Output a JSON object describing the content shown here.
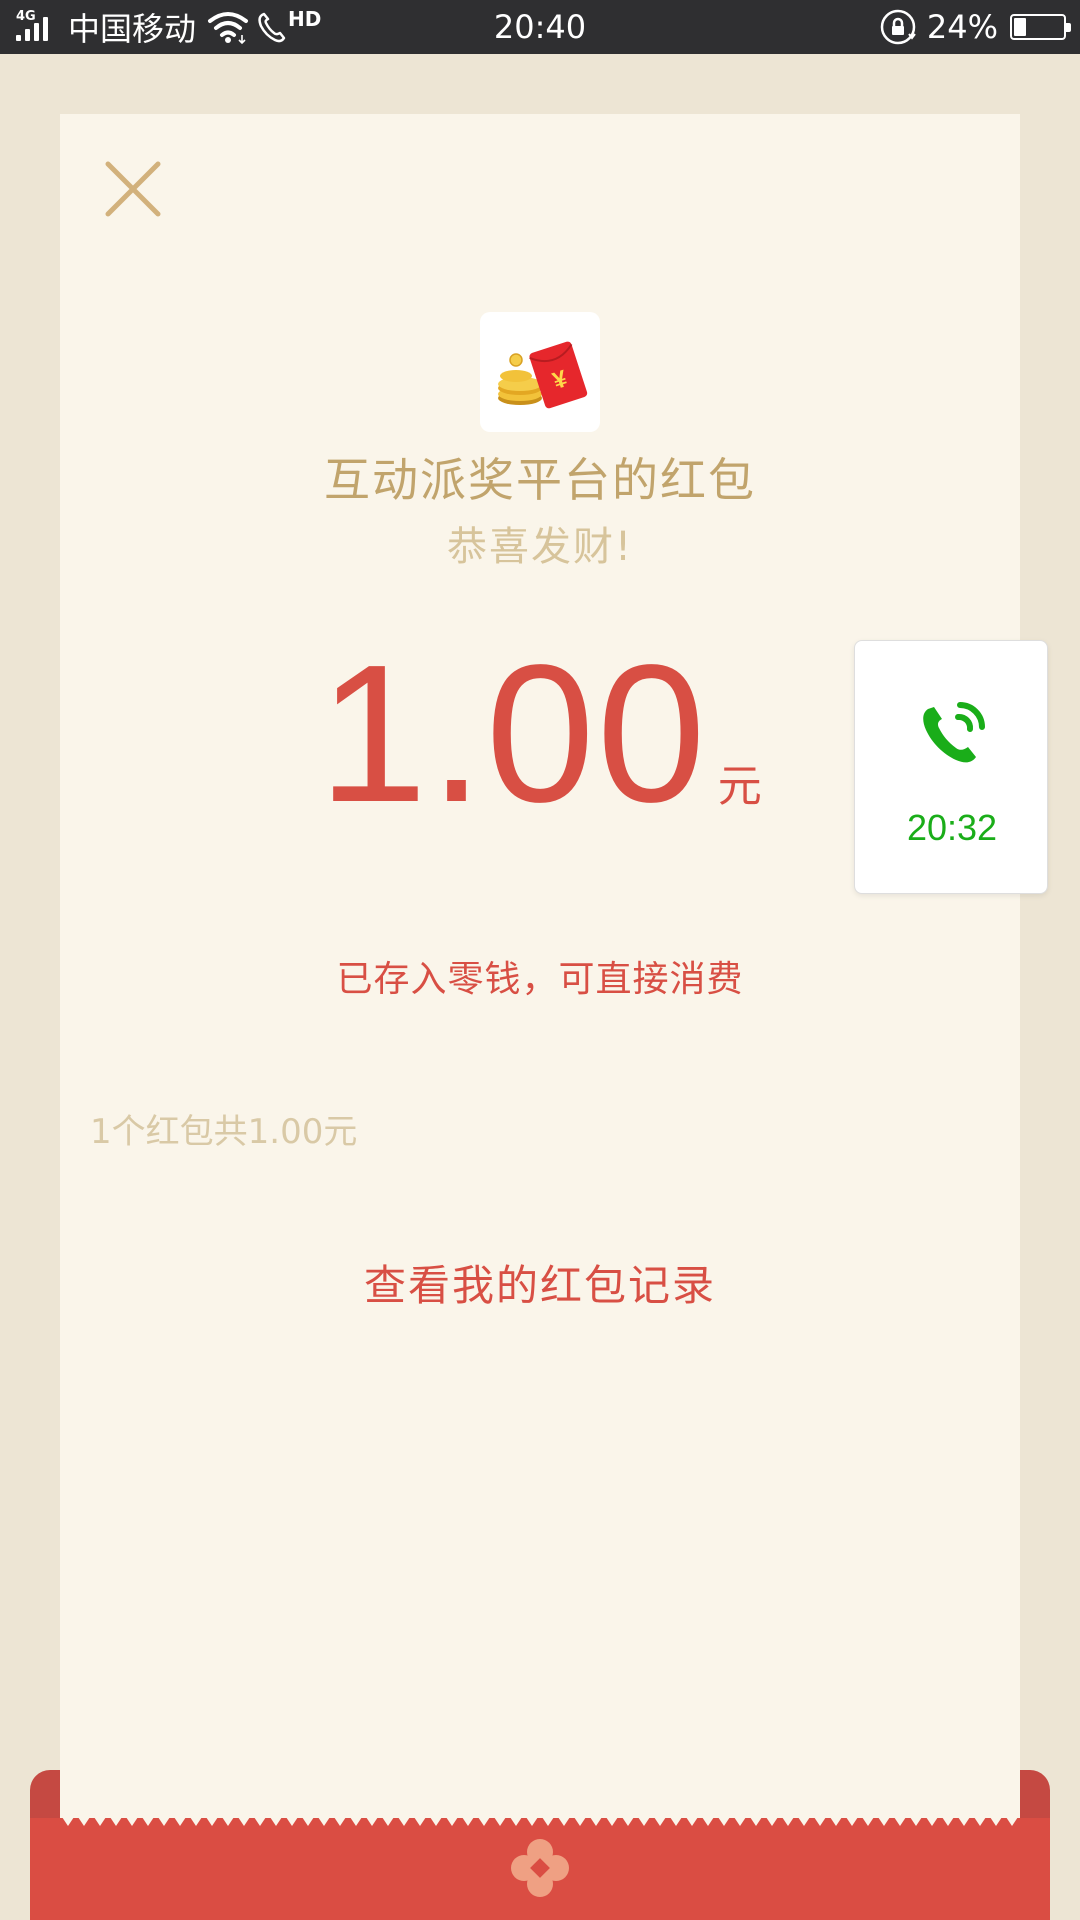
{
  "status_bar": {
    "network_type": "4G",
    "carrier": "中国移动",
    "volte_label": "HD",
    "time": "20:40",
    "battery_percent": "24%",
    "battery_level": 0.24
  },
  "packet": {
    "sender_name": "互动派奖平台的红包",
    "greeting": "恭喜发财!",
    "amount": "1.00",
    "unit": "元",
    "deposit_note": "已存入零钱，可直接消费",
    "summary": "1个红包共1.00元",
    "records_link": "查看我的红包记录"
  },
  "call_widget": {
    "duration": "20:32"
  },
  "colors": {
    "accent_red": "#d84f44",
    "gold_text": "#c1a46c",
    "call_green": "#1aad19"
  },
  "icons": [
    "signal-icon",
    "wifi-icon",
    "volte-call-icon",
    "rotation-lock-icon",
    "battery-icon",
    "close-icon",
    "red-packet-coins-icon",
    "phone-call-icon",
    "flower-logo-icon"
  ]
}
